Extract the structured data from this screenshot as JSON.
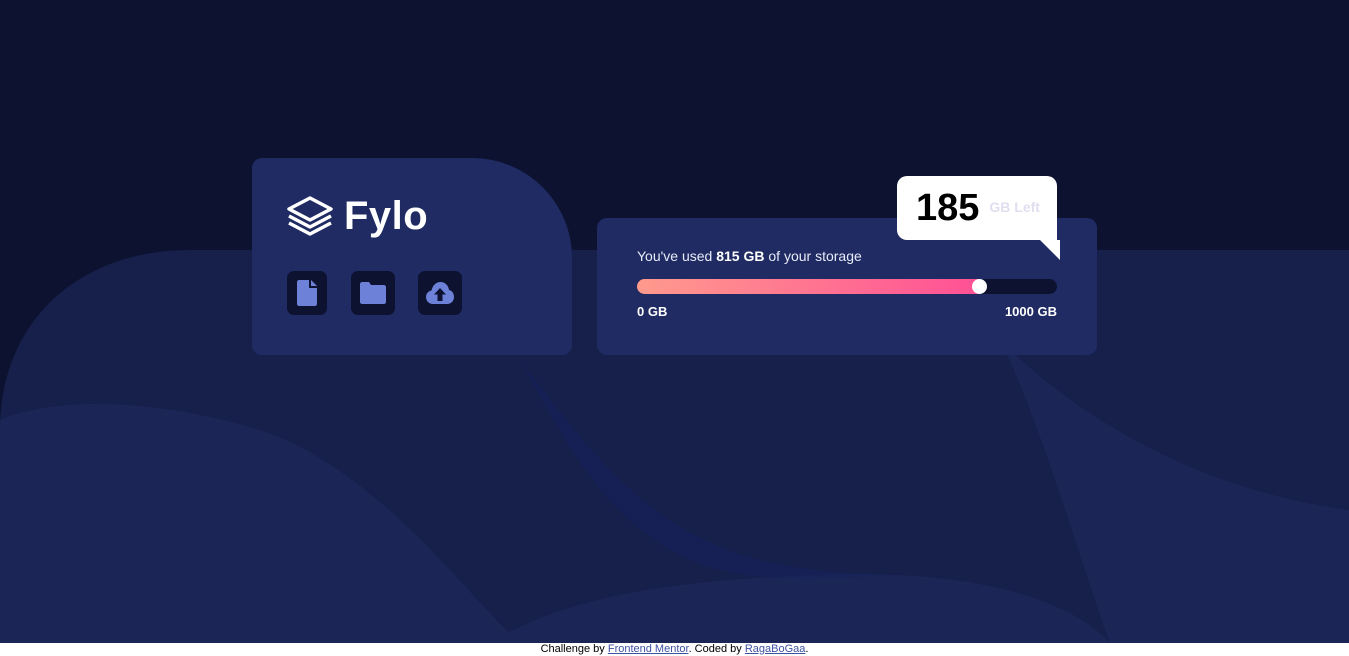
{
  "brand": {
    "name": "Fylo",
    "logo_icon": "layers-icon"
  },
  "toolbar": {
    "buttons": [
      {
        "icon": "document-icon"
      },
      {
        "icon": "folder-icon"
      },
      {
        "icon": "upload-icon"
      }
    ]
  },
  "storage": {
    "usage_prefix": "You've used ",
    "usage_amount": "815 GB",
    "usage_suffix": " of your storage",
    "used_fraction": 0.815,
    "min_label": "0 GB",
    "max_label": "1000 GB",
    "remaining_value": "185",
    "remaining_label": "GB Left"
  },
  "footer": {
    "prefix": "Challenge by ",
    "link1": "Frontend Mentor",
    "middle": ". Coded by ",
    "link2": "RagaBoGaa",
    "suffix": "."
  },
  "colors": {
    "background": "#0c1230",
    "card": "#1f2b62",
    "gradient_start": "#ff9a8d",
    "gradient_end": "#ff4f95",
    "icon_accent": "#6e81d9"
  }
}
